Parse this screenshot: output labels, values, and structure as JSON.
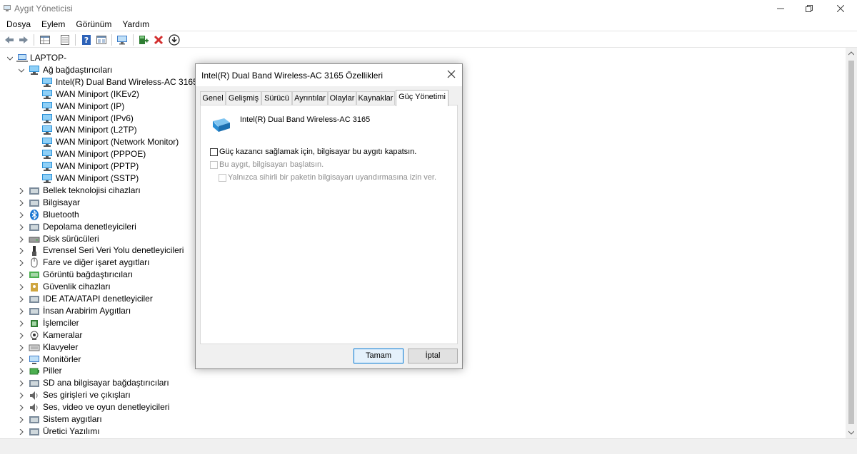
{
  "window": {
    "title": "Aygıt Yöneticisi"
  },
  "menu": [
    "Dosya",
    "Eylem",
    "Görünüm",
    "Yardım"
  ],
  "toolbar": [
    "back-icon",
    "forward-icon",
    "properties-grid-icon",
    "show-hidden-icon",
    "help-icon",
    "view-icon",
    "monitor-icon",
    "add-driver-icon",
    "uninstall-icon",
    "update-driver-icon"
  ],
  "tree": {
    "root": "LAPTOP-",
    "network_category": "Ağ bağdaştırıcıları",
    "network_children": [
      "Intel(R) Dual Band Wireless-AC 3165",
      "WAN Miniport (IKEv2)",
      "WAN Miniport (IP)",
      "WAN Miniport (IPv6)",
      "WAN Miniport (L2TP)",
      "WAN Miniport (Network Monitor)",
      "WAN Miniport (PPPOE)",
      "WAN Miniport (PPTP)",
      "WAN Miniport (SSTP)"
    ],
    "categories": [
      "Bellek teknolojisi cihazları",
      "Bilgisayar",
      "Bluetooth",
      "Depolama denetleyicileri",
      "Disk sürücüleri",
      "Evrensel Seri Veri Yolu denetleyicileri",
      "Fare ve diğer işaret aygıtları",
      "Görüntü bağdaştırıcıları",
      "Güvenlik cihazları",
      "IDE ATA/ATAPI denetleyiciler",
      "İnsan Arabirim Aygıtları",
      "İşlemciler",
      "Kameralar",
      "Klavyeler",
      "Monitörler",
      "Piller",
      "SD ana bilgisayar bağdaştırıcıları",
      "Ses girişleri ve çıkışları",
      "Ses, video ve oyun denetleyicileri",
      "Sistem aygıtları",
      "Üretici Yazılımı"
    ]
  },
  "dialog": {
    "title": "Intel(R) Dual Band Wireless-AC 3165 Özellikleri",
    "tabs": [
      "Genel",
      "Gelişmiş",
      "Sürücü",
      "Ayrıntılar",
      "Olaylar",
      "Kaynaklar",
      "Güç Yönetimi"
    ],
    "active_tab": "Güç Yönetimi",
    "device_name": "Intel(R) Dual Band Wireless-AC 3165",
    "options": [
      {
        "label": "Güç kazancı sağlamak için, bilgisayar bu aygıtı kapatsın.",
        "checked": false,
        "enabled": true
      },
      {
        "label": "Bu aygıt, bilgisayarı başlatsın.",
        "checked": false,
        "enabled": false
      },
      {
        "label": "Yalnızca sihirli bir paketin bilgisayarı uyandırmasına izin ver.",
        "checked": false,
        "enabled": false
      }
    ],
    "ok_label": "Tamam",
    "cancel_label": "İptal"
  },
  "colors": {
    "accent": "#0078d7",
    "network_icon": "#2a8fd6",
    "disabled_text": "#8d8d8d"
  }
}
